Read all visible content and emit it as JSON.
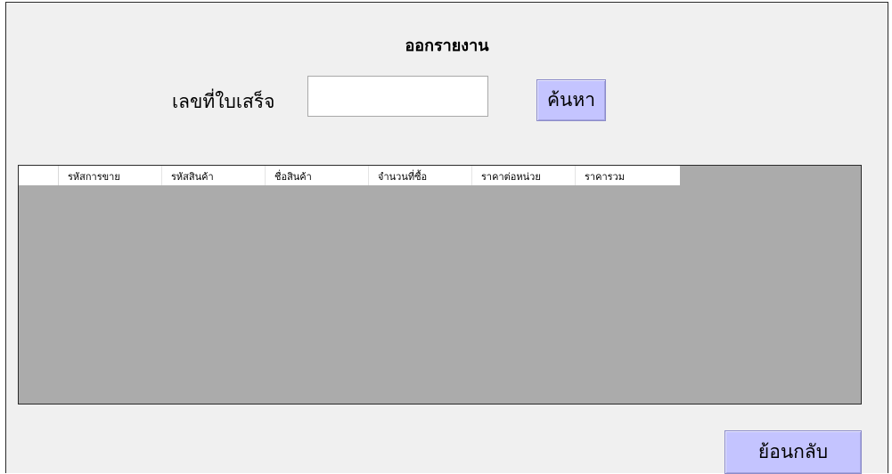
{
  "form": {
    "title": "ออกรายงาน",
    "receipt_label": "เลขที่ใบเสร็จ",
    "receipt_input": {
      "value": "",
      "placeholder": ""
    },
    "search_button_label": "ค้นหา",
    "back_button_label": "ย้อนกลับ"
  },
  "grid": {
    "columns": [
      "รหัสการขาย",
      "รหัสสินค้า",
      "ชื่อสินค้า",
      "จำนวนที่ซื้อ",
      "ราคาต่อหน่วย",
      "ราคารวม"
    ],
    "rows": []
  },
  "colors": {
    "form_background": "#f0f0f0",
    "button_background": "#c4c4ff",
    "grid_background": "#ababab"
  }
}
